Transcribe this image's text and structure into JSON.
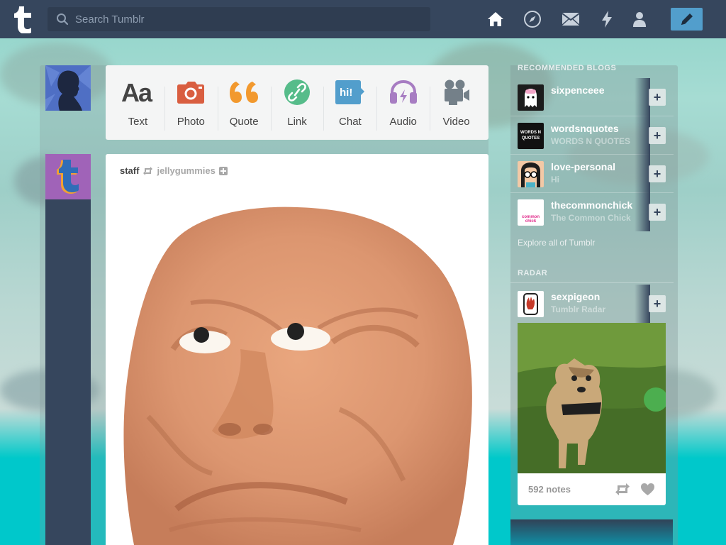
{
  "header": {
    "search_placeholder": "Search Tumblr",
    "nav": [
      "home-icon",
      "explore-icon",
      "inbox-icon",
      "activity-icon",
      "account-icon"
    ],
    "compose": "pencil-icon"
  },
  "post_types": [
    {
      "label": "Text",
      "icon": "text-icon",
      "color": "#444444"
    },
    {
      "label": "Photo",
      "icon": "camera-icon",
      "color": "#d95e40"
    },
    {
      "label": "Quote",
      "icon": "quote-icon",
      "color": "#f2992e"
    },
    {
      "label": "Link",
      "icon": "link-icon",
      "color": "#56bc8a"
    },
    {
      "label": "Chat",
      "icon": "chat-icon",
      "color": "#529ecc"
    },
    {
      "label": "Audio",
      "icon": "headphones-icon",
      "color": "#a77dc2"
    },
    {
      "label": "Video",
      "icon": "video-camera-icon",
      "color": "#748089"
    }
  ],
  "post": {
    "author": "staff",
    "reblogged_from": "jellygummies"
  },
  "sidebar": {
    "recommended_title": "Recommended Blogs",
    "blogs": [
      {
        "name": "sixpenceee",
        "subtitle": ""
      },
      {
        "name": "wordsnquotes",
        "subtitle": "WORDS N QUOTES",
        "avatar_text": "WORDS N QUOTES"
      },
      {
        "name": "love-personal",
        "subtitle": "Hi"
      },
      {
        "name": "thecommonchick",
        "subtitle": "The Common Chick",
        "avatar_text": "common chick"
      }
    ],
    "explore_label": "Explore all of Tumblr",
    "radar_title": "Radar",
    "radar": {
      "name": "sexpigeon",
      "subtitle": "Tumblr Radar",
      "notes": "592 notes"
    }
  },
  "colors": {
    "header": "#36465d",
    "compose": "#529ecc"
  }
}
